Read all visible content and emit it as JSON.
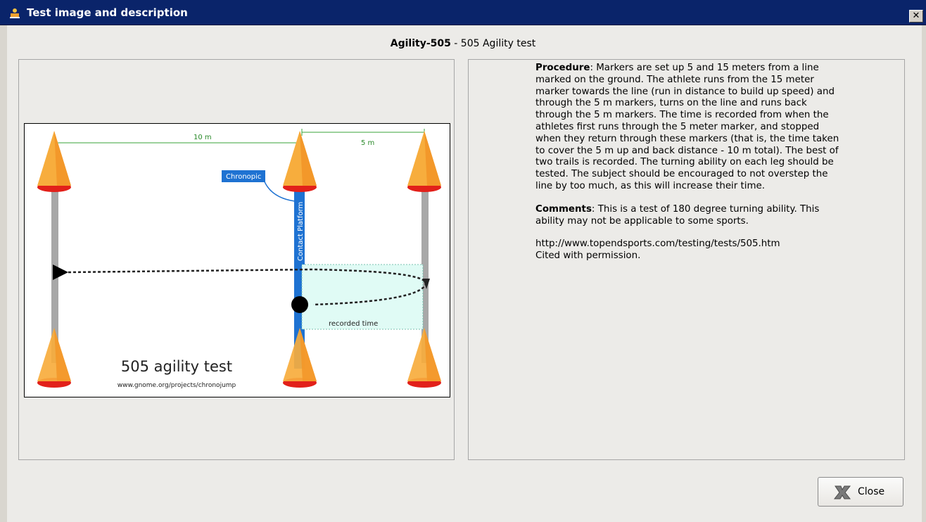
{
  "window": {
    "title": "Test image and description",
    "close_glyph": "✕"
  },
  "header": {
    "test_code": "Agility-505",
    "test_name": " - 505 Agility test"
  },
  "diagram": {
    "label_10m": "10 m",
    "label_5m": "5 m",
    "chronopic": "Chronopic",
    "contact_platform": "Contact Platform",
    "recorded_time": "recorded time",
    "caption_title": "505 agility test",
    "caption_url": "www.gnome.org/projects/chronojump"
  },
  "description": {
    "procedure_label": "Procedure",
    "procedure_text": ": Markers are set up 5 and 15 meters from a line marked on the ground. The athlete runs from the 15 meter marker towards the line (run in distance to build up speed) and through the 5 m markers, turns on the line and runs back through the 5 m markers. The time is recorded from when the athletes first runs through the 5 meter marker, and stopped when they return through these markers (that is, the time taken to cover the 5 m up and back distance - 10 m total). The best of two trails is recorded. The turning ability on each leg should be tested. The subject should be encouraged to not overstep the line by too much, as this will increase their time.",
    "comments_label": "Comments",
    "comments_text": ": This is a test of 180 degree turning ability. This ability may not be applicable to some sports.",
    "source_url": "http://www.topendsports.com/testing/tests/505.htm",
    "citation": "Cited with permission."
  },
  "buttons": {
    "close_label": "Close"
  },
  "icons": {
    "app": "app-icon",
    "close_x": "close-x-icon"
  }
}
